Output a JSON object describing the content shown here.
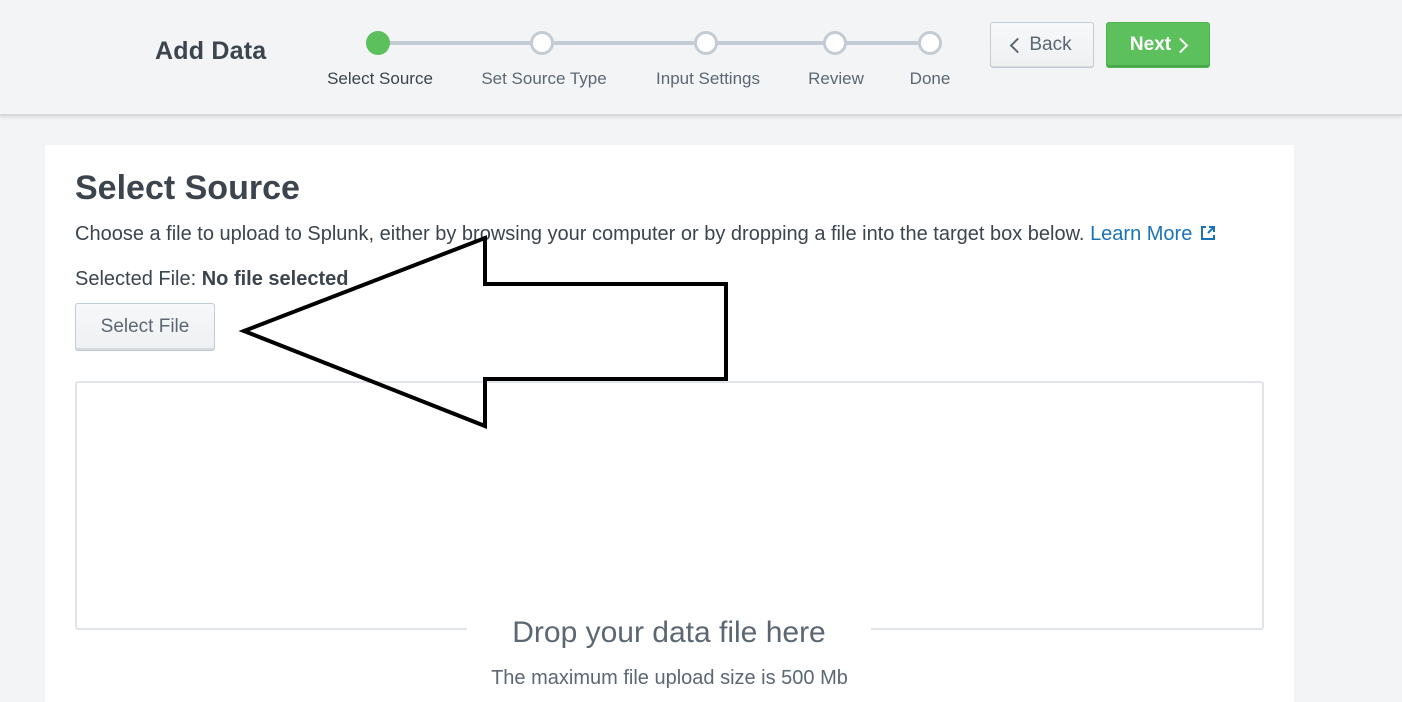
{
  "header": {
    "title": "Add Data",
    "back_label": "Back",
    "next_label": "Next"
  },
  "wizard": {
    "steps": [
      {
        "label": "Select Source",
        "state": "active"
      },
      {
        "label": "Set Source Type",
        "state": "pending"
      },
      {
        "label": "Input Settings",
        "state": "pending"
      },
      {
        "label": "Review",
        "state": "pending"
      },
      {
        "label": "Done",
        "state": "pending"
      }
    ]
  },
  "main": {
    "title": "Select Source",
    "description": "Choose a file to upload to Splunk, either by browsing your computer or by dropping a file into the target box below.",
    "learn_more": "Learn More",
    "selected_file_label": "Selected File:",
    "selected_file_value": "No file selected",
    "select_file_button": "Select File",
    "dropzone_title": "Drop your data file here",
    "dropzone_subtitle": "The maximum file upload size is 500 Mb"
  },
  "colors": {
    "accent_green": "#5cc05c",
    "link_blue": "#1a73b8",
    "text_dark": "#3c444d",
    "text_muted": "#5c6773"
  },
  "annotation": {
    "icon": "hand-drawn-arrow-icon",
    "points_to": "select-file-button"
  }
}
